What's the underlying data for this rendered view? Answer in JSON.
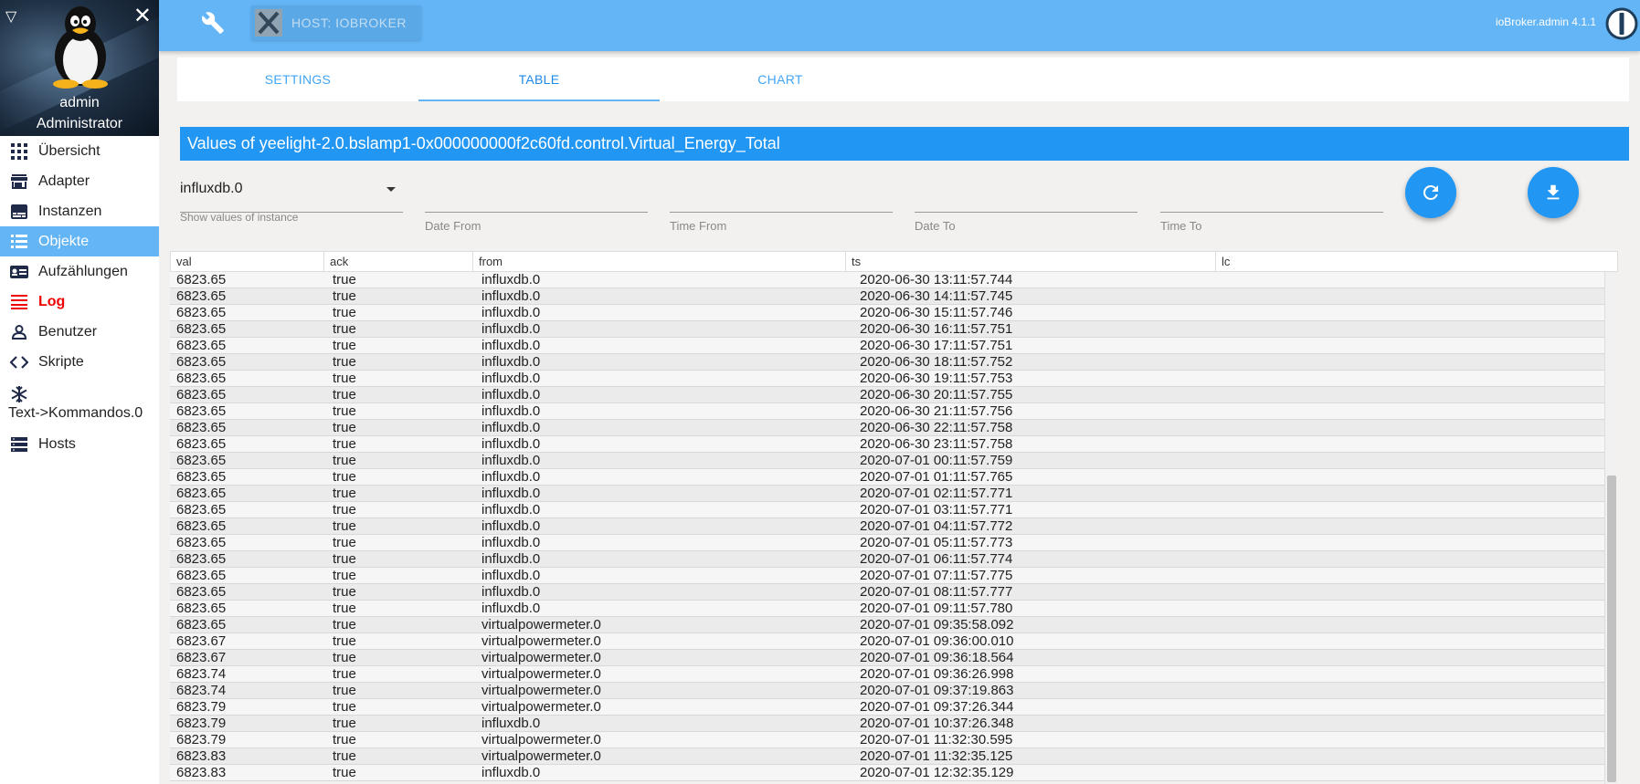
{
  "sidebar": {
    "user_name": "admin",
    "user_role": "Administrator",
    "items": [
      {
        "label": "Übersicht",
        "icon": "apps-grid-icon",
        "name": "sidebar-item-uebersicht"
      },
      {
        "label": "Adapter",
        "icon": "store-icon",
        "name": "sidebar-item-adapter"
      },
      {
        "label": "Instanzen",
        "icon": "instances-icon",
        "name": "sidebar-item-instanzen"
      },
      {
        "label": "Objekte",
        "icon": "list-icon",
        "name": "sidebar-item-objekte"
      },
      {
        "label": "Aufzählungen",
        "icon": "enum-card-icon",
        "name": "sidebar-item-aufzaehlungen"
      },
      {
        "label": "Log",
        "icon": "log-lines-icon",
        "name": "sidebar-item-log"
      },
      {
        "label": "Benutzer",
        "icon": "user-icon",
        "name": "sidebar-item-benutzer"
      },
      {
        "label": "Skripte",
        "icon": "code-icon",
        "name": "sidebar-item-skripte"
      },
      {
        "label": "Text->Kommandos.0",
        "icon": "snowflake-icon",
        "name": "sidebar-item-text-kommandos"
      },
      {
        "label": "Hosts",
        "icon": "server-icon",
        "name": "sidebar-item-hosts"
      }
    ]
  },
  "topbar": {
    "host_label": "HOST: IOBROKER",
    "version": "ioBroker.admin 4.1.1"
  },
  "tabs": [
    "SETTINGS",
    "TABLE",
    "CHART"
  ],
  "dialog": {
    "title": "Values of yeelight-2.0.bslamp1-0x000000000f2c60fd.control.Virtual_Energy_Total"
  },
  "filters": {
    "instance_value": "influxdb.0",
    "instance_helper": "Show values of instance",
    "date_from": "Date From",
    "time_from": "Time From",
    "date_to": "Date To",
    "time_to": "Time To"
  },
  "table": {
    "columns": [
      "val",
      "ack",
      "from",
      "ts",
      "lc"
    ],
    "rows": [
      [
        "6823.65",
        "true",
        "influxdb.0",
        "2020-06-30 13:11:57.744",
        ""
      ],
      [
        "6823.65",
        "true",
        "influxdb.0",
        "2020-06-30 14:11:57.745",
        ""
      ],
      [
        "6823.65",
        "true",
        "influxdb.0",
        "2020-06-30 15:11:57.746",
        ""
      ],
      [
        "6823.65",
        "true",
        "influxdb.0",
        "2020-06-30 16:11:57.751",
        ""
      ],
      [
        "6823.65",
        "true",
        "influxdb.0",
        "2020-06-30 17:11:57.751",
        ""
      ],
      [
        "6823.65",
        "true",
        "influxdb.0",
        "2020-06-30 18:11:57.752",
        ""
      ],
      [
        "6823.65",
        "true",
        "influxdb.0",
        "2020-06-30 19:11:57.753",
        ""
      ],
      [
        "6823.65",
        "true",
        "influxdb.0",
        "2020-06-30 20:11:57.755",
        ""
      ],
      [
        "6823.65",
        "true",
        "influxdb.0",
        "2020-06-30 21:11:57.756",
        ""
      ],
      [
        "6823.65",
        "true",
        "influxdb.0",
        "2020-06-30 22:11:57.758",
        ""
      ],
      [
        "6823.65",
        "true",
        "influxdb.0",
        "2020-06-30 23:11:57.758",
        ""
      ],
      [
        "6823.65",
        "true",
        "influxdb.0",
        "2020-07-01 00:11:57.759",
        ""
      ],
      [
        "6823.65",
        "true",
        "influxdb.0",
        "2020-07-01 01:11:57.765",
        ""
      ],
      [
        "6823.65",
        "true",
        "influxdb.0",
        "2020-07-01 02:11:57.771",
        ""
      ],
      [
        "6823.65",
        "true",
        "influxdb.0",
        "2020-07-01 03:11:57.771",
        ""
      ],
      [
        "6823.65",
        "true",
        "influxdb.0",
        "2020-07-01 04:11:57.772",
        ""
      ],
      [
        "6823.65",
        "true",
        "influxdb.0",
        "2020-07-01 05:11:57.773",
        ""
      ],
      [
        "6823.65",
        "true",
        "influxdb.0",
        "2020-07-01 06:11:57.774",
        ""
      ],
      [
        "6823.65",
        "true",
        "influxdb.0",
        "2020-07-01 07:11:57.775",
        ""
      ],
      [
        "6823.65",
        "true",
        "influxdb.0",
        "2020-07-01 08:11:57.777",
        ""
      ],
      [
        "6823.65",
        "true",
        "influxdb.0",
        "2020-07-01 09:11:57.780",
        ""
      ],
      [
        "6823.65",
        "true",
        "virtualpowermeter.0",
        "2020-07-01 09:35:58.092",
        ""
      ],
      [
        "6823.67",
        "true",
        "virtualpowermeter.0",
        "2020-07-01 09:36:00.010",
        ""
      ],
      [
        "6823.67",
        "true",
        "virtualpowermeter.0",
        "2020-07-01 09:36:18.564",
        ""
      ],
      [
        "6823.74",
        "true",
        "virtualpowermeter.0",
        "2020-07-01 09:36:26.998",
        ""
      ],
      [
        "6823.74",
        "true",
        "virtualpowermeter.0",
        "2020-07-01 09:37:19.863",
        ""
      ],
      [
        "6823.79",
        "true",
        "virtualpowermeter.0",
        "2020-07-01 09:37:26.344",
        ""
      ],
      [
        "6823.79",
        "true",
        "influxdb.0",
        "2020-07-01 10:37:26.348",
        ""
      ],
      [
        "6823.79",
        "true",
        "virtualpowermeter.0",
        "2020-07-01 11:32:30.595",
        ""
      ],
      [
        "6823.83",
        "true",
        "virtualpowermeter.0",
        "2020-07-01 11:32:35.125",
        ""
      ],
      [
        "6823.83",
        "true",
        "influxdb.0",
        "2020-07-01 12:32:35.129",
        ""
      ]
    ]
  },
  "colors": {
    "accent": "#2196f3",
    "topbar": "#64b5f6",
    "log_red": "#ee0000"
  }
}
